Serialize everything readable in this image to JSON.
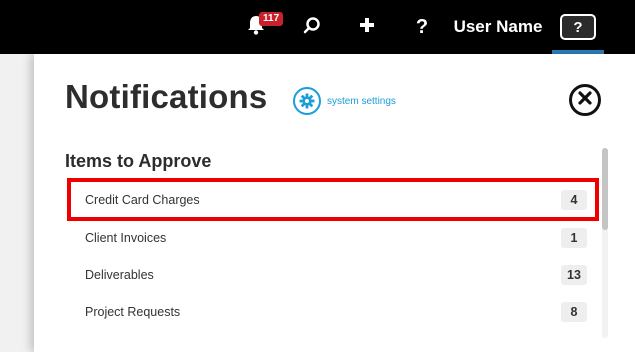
{
  "topbar": {
    "notification_count": "117",
    "help_label": "?",
    "user_name": "User Name",
    "help_box_label": "?"
  },
  "panel": {
    "title": "Notifications",
    "settings_label": "system settings",
    "section_heading": "Items to Approve",
    "items": [
      {
        "label": "Credit Card Charges",
        "count": "4"
      },
      {
        "label": "Client Invoices",
        "count": "1"
      },
      {
        "label": "Deliverables",
        "count": "13"
      },
      {
        "label": "Project Requests",
        "count": "8"
      }
    ]
  },
  "colors": {
    "accent": "#1a9ed9",
    "badge": "#c8212b",
    "highlight": "#ee0000"
  }
}
